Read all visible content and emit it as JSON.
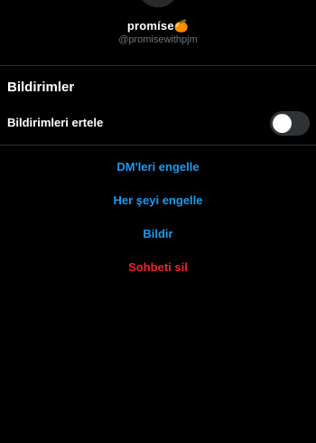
{
  "profile": {
    "name": "promíse🍊",
    "handle": "@promisewithpjm"
  },
  "notifications": {
    "title": "Bildirimler",
    "snooze_label": "Bildirimleri ertele",
    "snooze_enabled": false
  },
  "actions": [
    {
      "label": "DM'leri engelle",
      "color": "#1d9bf0"
    },
    {
      "label": "Her şeyi engelle",
      "color": "#1d9bf0"
    },
    {
      "label": "Bildir",
      "color": "#1d9bf0"
    },
    {
      "label": "Sohbeti sil",
      "color": "#f4212e"
    }
  ],
  "colors": {
    "background": "#000000",
    "accent": "#1d9bf0",
    "danger": "#f4212e",
    "toggle_off": "#2f3336"
  }
}
